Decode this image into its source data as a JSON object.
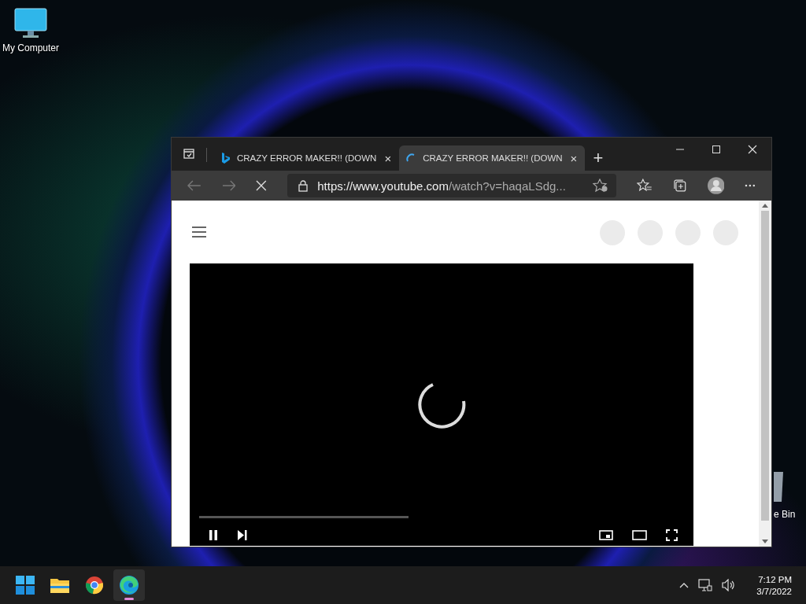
{
  "desktop": {
    "icons": [
      {
        "kind": "computer",
        "label": "My Computer"
      },
      {
        "kind": "bin",
        "label": "e Bin"
      }
    ]
  },
  "browser": {
    "tabs": [
      {
        "title": "CRAZY ERROR MAKER!! (DOWN",
        "kind": "site",
        "selected": false,
        "close": "×"
      },
      {
        "title": "CRAZY ERROR MAKER!! (DOWN",
        "kind": "loading",
        "selected": true,
        "close": "×"
      }
    ],
    "new_tab": "+",
    "url": {
      "host": "https://www.youtube.com",
      "path": "/watch?v=haqaLSdg..."
    },
    "loading": true
  },
  "taskbar": {
    "apps": [
      {
        "kind": "start",
        "active": false
      },
      {
        "kind": "explorer",
        "active": false
      },
      {
        "kind": "chrome",
        "active": false
      },
      {
        "kind": "edge",
        "active": true
      }
    ],
    "time": "7:12 PM",
    "date": "3/7/2022"
  }
}
